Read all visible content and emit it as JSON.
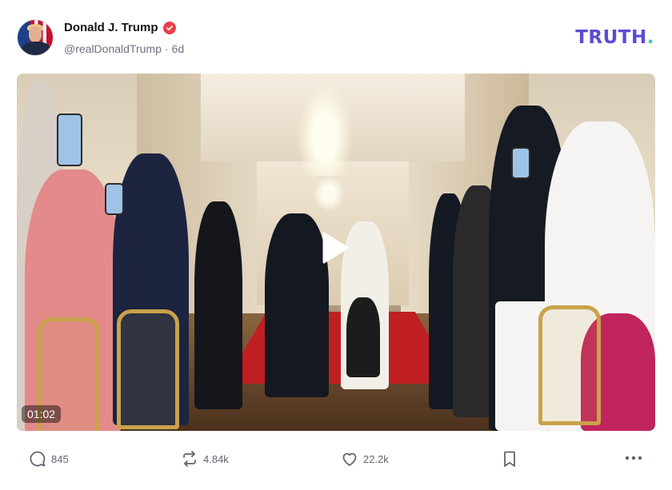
{
  "post": {
    "author": {
      "display_name": "Donald J. Trump",
      "handle": "@realDonaldTrump",
      "separator": "·",
      "time_ago": "6d",
      "verified_icon": "verified-badge-icon",
      "verified_color": "#e8404a"
    },
    "brand": {
      "logo_text": "TRUTH",
      "logo_dot": ".",
      "logo_color": "#5a4bd6",
      "logo_dot_color": "#2dd4c8"
    },
    "media": {
      "type": "video",
      "duration": "01:02",
      "play_icon": "play-icon"
    },
    "actions": {
      "replies": {
        "icon": "reply-icon",
        "count": "845"
      },
      "retruths": {
        "icon": "retruth-icon",
        "count": "4.84k"
      },
      "likes": {
        "icon": "heart-icon",
        "count": "22.2k"
      },
      "bookmark": {
        "icon": "bookmark-icon"
      },
      "more": {
        "icon": "more-dots-icon"
      }
    }
  }
}
